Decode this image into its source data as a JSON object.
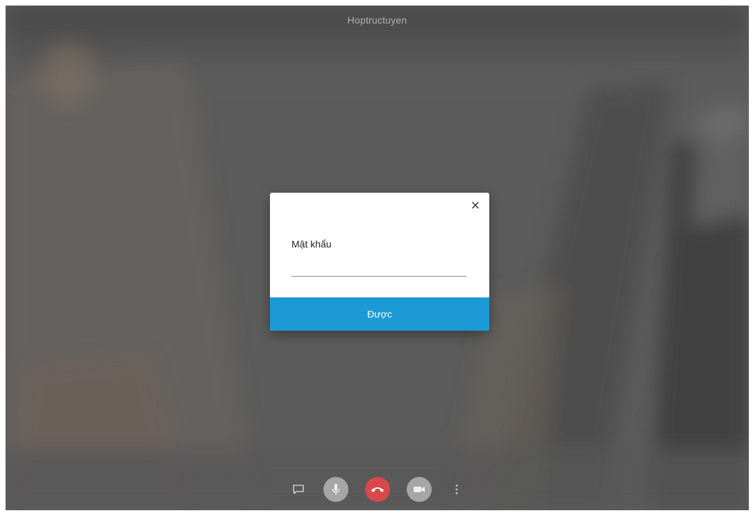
{
  "meeting": {
    "title": "Hoptructuyen"
  },
  "password_dialog": {
    "label": "Mật khẩu",
    "input_value": "",
    "input_placeholder": "",
    "submit_label": "Được",
    "close_icon": "close-icon"
  },
  "toolbar": {
    "items": [
      {
        "icon": "chat-icon"
      },
      {
        "icon": "microphone-icon"
      },
      {
        "icon": "hangup-icon"
      },
      {
        "icon": "camera-icon"
      },
      {
        "icon": "more-vertical-icon"
      }
    ]
  },
  "colors": {
    "accent": "#1b9ad6",
    "hangup": "#d9484a",
    "control": "#a6a6a6"
  }
}
